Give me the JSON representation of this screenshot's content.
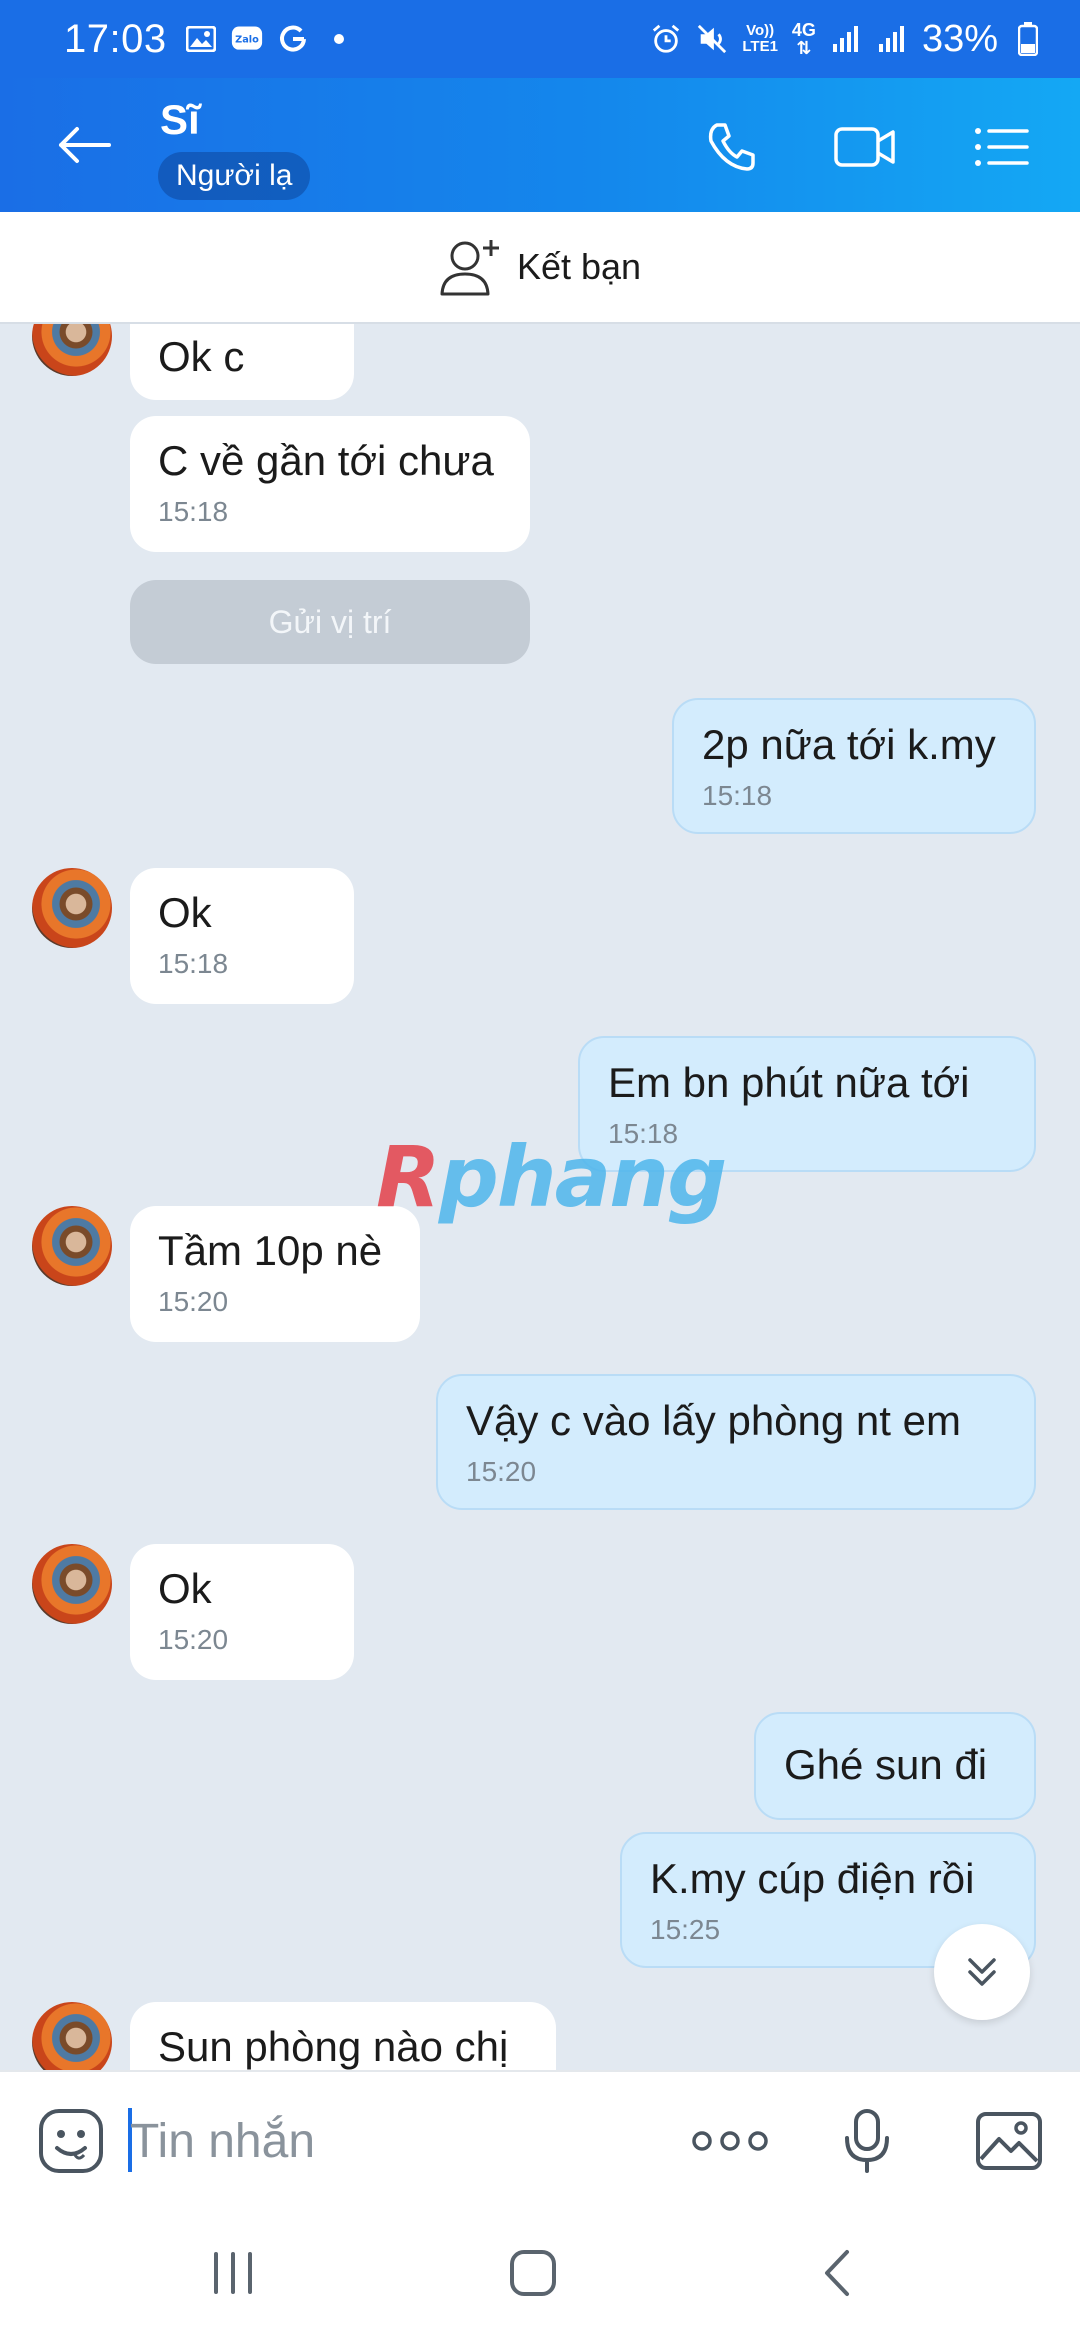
{
  "status_bar": {
    "time": "17:03",
    "battery": "33%",
    "network_top": "Vo))",
    "network_bottom": "LTE1",
    "network_gen": "4G",
    "left_icons": [
      "image-icon",
      "zalo-icon",
      "google-icon",
      "dot-icon"
    ],
    "right_icons": [
      "alarm-icon",
      "mute-icon",
      "signal-icon",
      "signal-icon",
      "battery-icon"
    ]
  },
  "header": {
    "name": "Sĩ",
    "badge": "Người lạ",
    "icons": [
      "back-arrow-icon",
      "phone-icon",
      "video-call-icon",
      "menu-list-icon"
    ]
  },
  "add_friend": {
    "label": "Kết bạn",
    "icon": "add-person-icon"
  },
  "messages": [
    {
      "side": "in",
      "text": "Ok c",
      "time": ""
    },
    {
      "side": "in",
      "text": "C về gần tới chưa",
      "time": "15:18"
    },
    {
      "side": "action",
      "text": "Gửi vị trí"
    },
    {
      "side": "out",
      "text": "2p nữa tới k.my",
      "time": "15:18"
    },
    {
      "side": "in",
      "text": "Ok",
      "time": "15:18"
    },
    {
      "side": "out",
      "text": "Em bn phút  nữa  tới",
      "time": "15:18"
    },
    {
      "side": "in",
      "text": "Tầm 10p nè",
      "time": "15:20"
    },
    {
      "side": "out",
      "text": "Vậy c vào lấy phòng  nt  em",
      "time": "15:20"
    },
    {
      "side": "in",
      "text": "Ok",
      "time": "15:20"
    },
    {
      "side": "out",
      "text": "Ghé  sun đi",
      "time": ""
    },
    {
      "side": "out",
      "text": "K.my cúp điện  rồi",
      "time": "15:25"
    },
    {
      "side": "in",
      "text": "Sun phòng nào chị",
      "time": ""
    }
  ],
  "watermark": {
    "first": "R",
    "rest": "phang"
  },
  "input": {
    "placeholder": "Tin nhắn",
    "value": "",
    "icons": [
      "sticker-icon",
      "more-dots-icon",
      "microphone-icon",
      "image-icon"
    ]
  },
  "nav": {
    "icons": [
      "recent-apps-icon",
      "home-icon",
      "back-icon"
    ]
  },
  "colors": {
    "header_start": "#1a6ee6",
    "header_end": "#14a8f4",
    "chat_bg": "#e2e9f1",
    "bubble_out": "#d3ecfd",
    "bubble_in": "#ffffff",
    "time_text": "#7c8791"
  }
}
